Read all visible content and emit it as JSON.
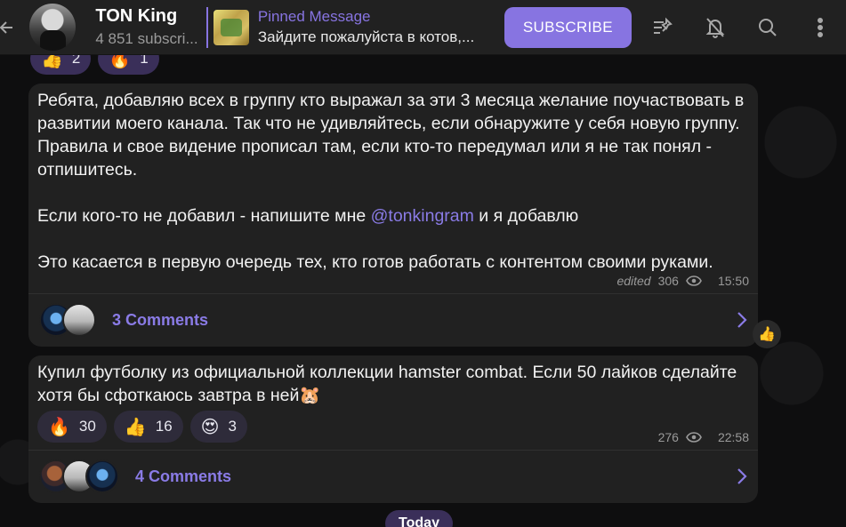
{
  "header": {
    "channel_title": "TON King",
    "channel_subtitle": "4 851 subscri...",
    "pinned_label": "Pinned Message",
    "pinned_text": "Зайдите пожалуйста в котов,...",
    "subscribe_label": "SUBSCRIBE",
    "icons": [
      "back-arrow-icon",
      "pin-list-icon",
      "mute-bell-icon",
      "search-icon",
      "more-vertical-icon"
    ]
  },
  "top_reactions": [
    {
      "emoji": "👍",
      "count": "2"
    },
    {
      "emoji": "🔥",
      "count": "1"
    }
  ],
  "message1": {
    "para1": "Ребята, добавляю всех в группу кто выражал за эти 3 месяца желание поучаствовать в развитии моего канала. Так что не удивляйтесь, если обнаружите у себя новую группу. Правила и свое видение прописал там, если кто-то передумал или я не так понял - отпишитесь.",
    "para2_before": "Если кого-то не добавил - напишите мне ",
    "mention": "@tonkingram",
    "para2_after": " и я добавлю",
    "para3": "Это касается в первую очередь тех, кто готов работать с контентом своими руками.",
    "edited": "edited",
    "views": "306",
    "time": "15:50",
    "comments": "3 Comments"
  },
  "side_reaction": "👍",
  "message2": {
    "text": "Купил футболку из официальной коллекции hamster combat. Если 50 лайков сделайте хотя бы сфоткаюсь завтра в ней🐹",
    "reactions": [
      {
        "emoji": "🔥",
        "count": "30"
      },
      {
        "emoji": "👍",
        "count": "16"
      },
      {
        "emoji": "😍",
        "count": "3"
      }
    ],
    "views": "276",
    "time": "22:58",
    "comments": "4 Comments"
  },
  "date_badge": "Today",
  "colors": {
    "accent": "#8774e1",
    "bubble": "#212121",
    "header": "#212121",
    "link": "#8a7be6"
  }
}
